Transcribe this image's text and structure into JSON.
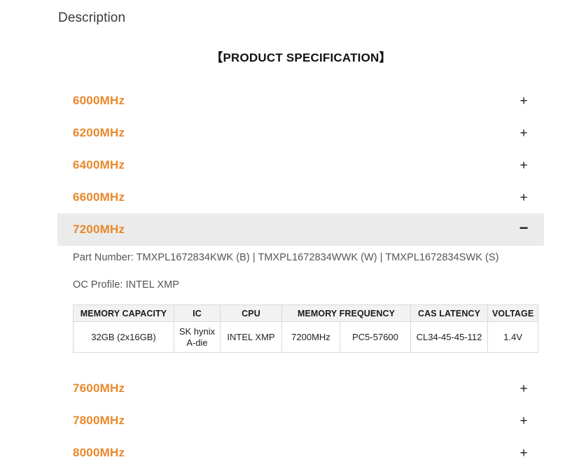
{
  "page": {
    "description_heading": "Description",
    "spec_title": "【PRODUCT SPECIFICATION】"
  },
  "colors": {
    "accent_orange": "#E9882B",
    "link_blue": "#3A8DDD",
    "open_row_background": "#EBEBEB",
    "table_header_background": "#F2F2F2",
    "table_border": "#D9D9D9"
  },
  "icons": {
    "expand": "+",
    "collapse": "−"
  },
  "accordion": {
    "items": [
      {
        "label": "6000MHz",
        "open": false,
        "toggle": "+"
      },
      {
        "label": "6200MHz",
        "open": false,
        "toggle": "+"
      },
      {
        "label": "6400MHz",
        "open": false,
        "toggle": "+"
      },
      {
        "label": "6600MHz",
        "open": false,
        "toggle": "+"
      },
      {
        "label": "7200MHz",
        "open": true,
        "toggle": "−"
      },
      {
        "label": "7600MHz",
        "open": false,
        "toggle": "+"
      },
      {
        "label": "7800MHz",
        "open": false,
        "toggle": "+"
      },
      {
        "label": "8000MHz",
        "open": false,
        "toggle": "+"
      }
    ]
  },
  "expanded_panel": {
    "part_number": "Part Number: TMXPL1672834KWK (B) | TMXPL1672834WWK (W) | TMXPL1672834SWK (S)",
    "oc_profile": "OC Profile: INTEL XMP",
    "table": {
      "headers": [
        "MEMORY CAPACITY",
        "IC",
        "CPU",
        "MEMORY FREQUENCY",
        "CAS LATENCY",
        "VOLTAGE"
      ],
      "row": {
        "memory_capacity": "32GB (2x16GB)",
        "ic": "SK hynix A-die",
        "cpu": "INTEL XMP",
        "memory_frequency": "7200MHz",
        "memory_speed": "PC5-57600",
        "cas_latency": "CL34-45-45-112",
        "voltage": "1.4V"
      }
    }
  }
}
